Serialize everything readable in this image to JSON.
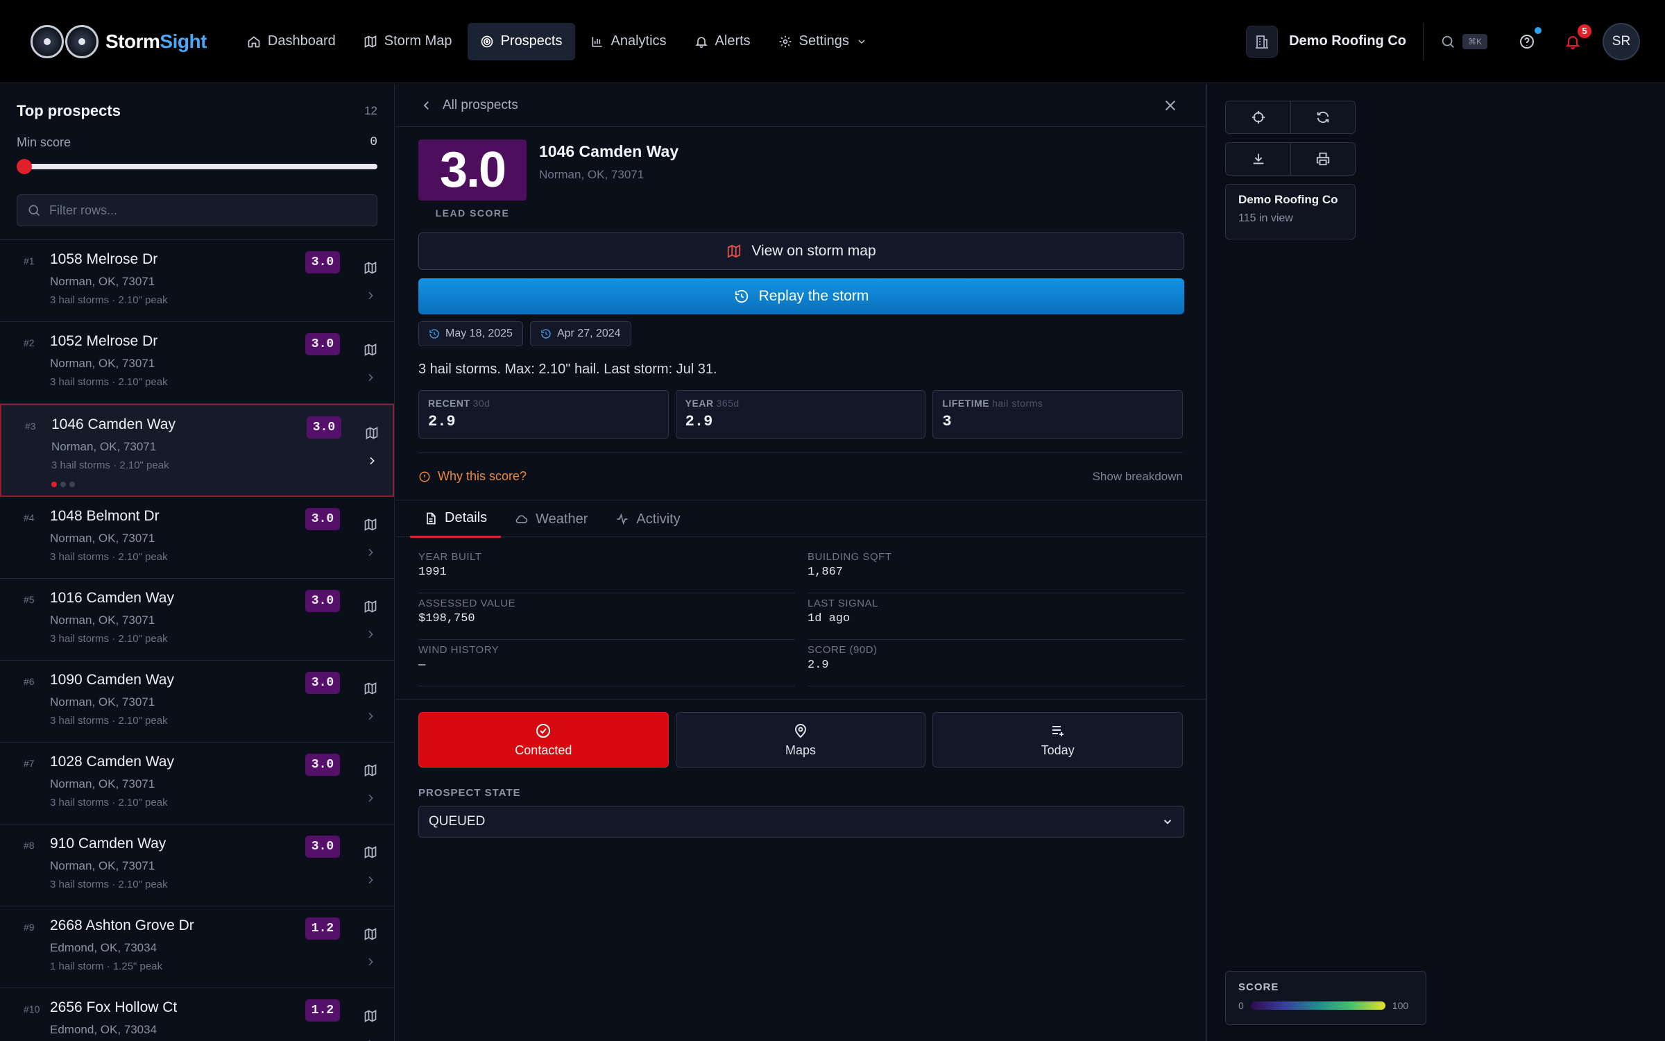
{
  "brand": {
    "name_part1": "Storm",
    "name_part2": "Sight"
  },
  "nav": {
    "items": [
      {
        "label": "Dashboard",
        "icon": "home-icon"
      },
      {
        "label": "Storm Map",
        "icon": "map-icon"
      },
      {
        "label": "Prospects",
        "icon": "target-icon",
        "active": true
      },
      {
        "label": "Analytics",
        "icon": "bar-chart-icon"
      },
      {
        "label": "Alerts",
        "icon": "bell-icon"
      },
      {
        "label": "Settings",
        "icon": "gear-icon"
      }
    ]
  },
  "header": {
    "org_name": "Demo Roofing Co",
    "search_shortcut": "⌘K",
    "notifications_count": "5",
    "avatar_initials": "SR"
  },
  "left": {
    "title": "Top prospects",
    "count": "12",
    "min_score_label": "Min score",
    "min_score_value": "0",
    "min_score_fraction": 0,
    "filter_placeholder": "Filter rows...",
    "rows": [
      {
        "rank": "#1",
        "address": "1058 Melrose Dr",
        "city": "Norman, OK, 73071",
        "meta": "3 hail storms · 2.10\" peak",
        "score": "3.0"
      },
      {
        "rank": "#2",
        "address": "1052 Melrose Dr",
        "city": "Norman, OK, 73071",
        "meta": "3 hail storms · 2.10\" peak",
        "score": "3.0"
      },
      {
        "rank": "#3",
        "address": "1046 Camden Way",
        "city": "Norman, OK, 73071",
        "meta": "3 hail storms · 2.10\" peak",
        "score": "3.0",
        "selected": true
      },
      {
        "rank": "#4",
        "address": "1048 Belmont Dr",
        "city": "Norman, OK, 73071",
        "meta": "3 hail storms · 2.10\" peak",
        "score": "3.0"
      },
      {
        "rank": "#5",
        "address": "1016 Camden Way",
        "city": "Norman, OK, 73071",
        "meta": "3 hail storms · 2.10\" peak",
        "score": "3.0"
      },
      {
        "rank": "#6",
        "address": "1090 Camden Way",
        "city": "Norman, OK, 73071",
        "meta": "3 hail storms · 2.10\" peak",
        "score": "3.0"
      },
      {
        "rank": "#7",
        "address": "1028 Camden Way",
        "city": "Norman, OK, 73071",
        "meta": "3 hail storms · 2.10\" peak",
        "score": "3.0"
      },
      {
        "rank": "#8",
        "address": "910 Camden Way",
        "city": "Norman, OK, 73071",
        "meta": "3 hail storms · 2.10\" peak",
        "score": "3.0"
      },
      {
        "rank": "#9",
        "address": "2668 Ashton Grove Dr",
        "city": "Edmond, OK, 73034",
        "meta": "1 hail storm · 1.25\" peak",
        "score": "1.2"
      },
      {
        "rank": "#10",
        "address": "2656 Fox Hollow Ct",
        "city": "Edmond, OK, 73034",
        "meta": "",
        "score": "1.2"
      }
    ]
  },
  "detail": {
    "back_label": "All prospects",
    "lead_score": "3.0",
    "lead_score_label": "LEAD SCORE",
    "address": "1046 Camden Way",
    "city": "Norman, OK, 73071",
    "view_map_label": "View on storm map",
    "replay_label": "Replay the storm",
    "chips": [
      "May 18, 2025",
      "Apr 27, 2024"
    ],
    "summary": "3 hail storms. Max: 2.10\" hail. Last storm: Jul 31.",
    "stats": [
      {
        "key": "RECENT",
        "sub": "30d",
        "value": "2.9"
      },
      {
        "key": "YEAR",
        "sub": "365d",
        "value": "2.9"
      },
      {
        "key": "LIFETIME",
        "sub": "hail storms",
        "value": "3"
      }
    ],
    "why_label": "Why this score?",
    "breakdown_label": "Show breakdown",
    "tabs": [
      {
        "label": "Details",
        "icon": "document-icon",
        "active": true
      },
      {
        "label": "Weather",
        "icon": "cloud-icon"
      },
      {
        "label": "Activity",
        "icon": "activity-icon"
      }
    ],
    "fields": [
      {
        "key": "YEAR BUILT",
        "value": "1991"
      },
      {
        "key": "BUILDING SQFT",
        "value": "1,867"
      },
      {
        "key": "ASSESSED VALUE",
        "value": "$198,750"
      },
      {
        "key": "LAST SIGNAL",
        "value": "1d ago"
      },
      {
        "key": "WIND HISTORY",
        "value": "—"
      },
      {
        "key": "SCORE (90D)",
        "value": "2.9"
      }
    ],
    "actions": [
      {
        "label": "Contacted",
        "icon": "check-circle-icon"
      },
      {
        "label": "Maps",
        "icon": "map-pin-icon"
      },
      {
        "label": "Today",
        "icon": "list-add-icon"
      }
    ],
    "prospect_state_label": "PROSPECT STATE",
    "prospect_state_value": "QUEUED"
  },
  "map_panel": {
    "org_name": "Demo Roofing Co",
    "in_view": "115 in view",
    "legend_title": "SCORE",
    "legend_min": "0",
    "legend_max": "100"
  },
  "colors": {
    "accent_red": "#e0202b",
    "accent_blue": "#1294e4",
    "score_purple": "#55106a"
  }
}
